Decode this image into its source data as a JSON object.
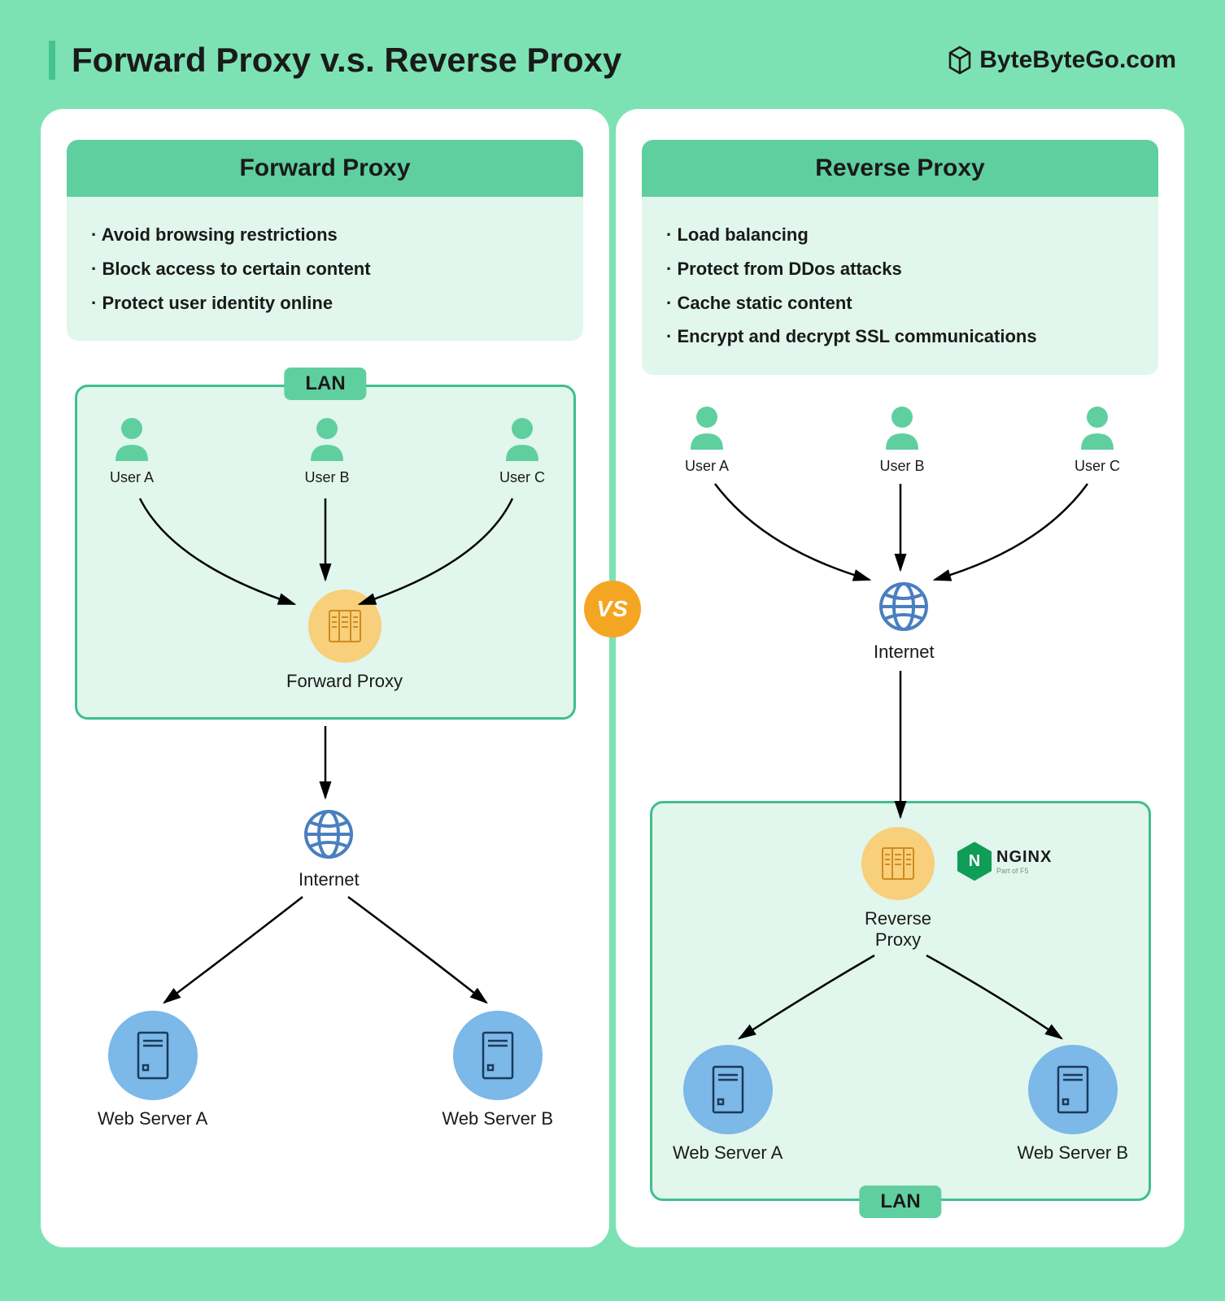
{
  "header": {
    "title": "Forward Proxy v.s. Reverse Proxy",
    "brand": "ByteByteGo.com"
  },
  "vs_label": "VS",
  "left": {
    "card_title": "Forward Proxy",
    "bullets": [
      "Avoid browsing restrictions",
      "Block access to certain content",
      "Protect user identity online"
    ],
    "lan_label": "LAN",
    "users": [
      "User A",
      "User B",
      "User C"
    ],
    "proxy_label": "Forward Proxy",
    "internet_label": "Internet",
    "servers": [
      "Web Server A",
      "Web Server B"
    ]
  },
  "right": {
    "card_title": "Reverse Proxy",
    "bullets": [
      "Load balancing",
      "Protect from DDos attacks",
      "Cache static content",
      "Encrypt and decrypt SSL communications"
    ],
    "lan_label": "LAN",
    "users": [
      "User A",
      "User B",
      "User C"
    ],
    "internet_label": "Internet",
    "proxy_label": "Reverse Proxy",
    "nginx_name": "NGINX",
    "nginx_sub": "Part of F5",
    "nginx_letter": "N",
    "servers": [
      "Web Server A",
      "Web Server B"
    ]
  }
}
